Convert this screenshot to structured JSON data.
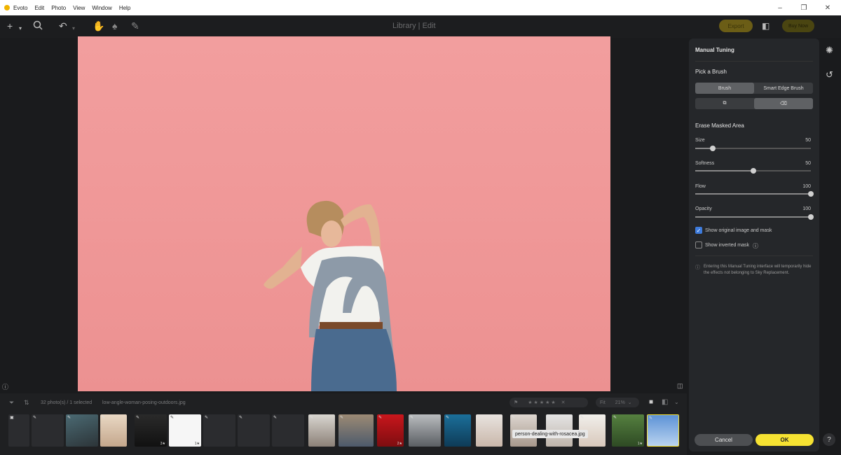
{
  "app": {
    "name": "Evoto"
  },
  "menu": [
    "Edit",
    "Photo",
    "View",
    "Window",
    "Help"
  ],
  "toolbar": {
    "mode_title": "Library | Edit",
    "export_label": "Export",
    "buy_label": "Buy Now",
    "avatar_letter": "C"
  },
  "panel": {
    "title": "Manual Tuning",
    "pick_brush": "Pick a Brush",
    "brush_options": [
      "Brush",
      "Smart Edge Brush"
    ],
    "erase_title": "Erase Masked Area",
    "sliders": [
      {
        "label": "Size",
        "value": "50",
        "fraction": 0.15
      },
      {
        "label": "Softness",
        "value": "50",
        "fraction": 0.5
      },
      {
        "label": "Flow",
        "value": "100",
        "fraction": 1.0
      },
      {
        "label": "Opacity",
        "value": "100",
        "fraction": 1.0
      }
    ],
    "show_original": "Show original image and mask",
    "show_inverted": "Show inverted mask",
    "note": "Entering this Manual Tuning interface will temporarily hide the effects not belonging to Sky Replacement.",
    "cancel_label": "Cancel",
    "ok_label": "OK"
  },
  "filmstrip": {
    "count": "32 photo(s) / 1 selected",
    "filename": "low-angle-woman-posing-outdoors.jpg",
    "zoom": "21%",
    "tooltip": "person-dealing-with-rosacea.jpg",
    "ratings": [
      "3★",
      "1★",
      "2★",
      "1★"
    ]
  },
  "colors": {
    "accent": "#f6e232",
    "sky_mask": "#ef9797",
    "checkbox": "#3d7bdc"
  }
}
